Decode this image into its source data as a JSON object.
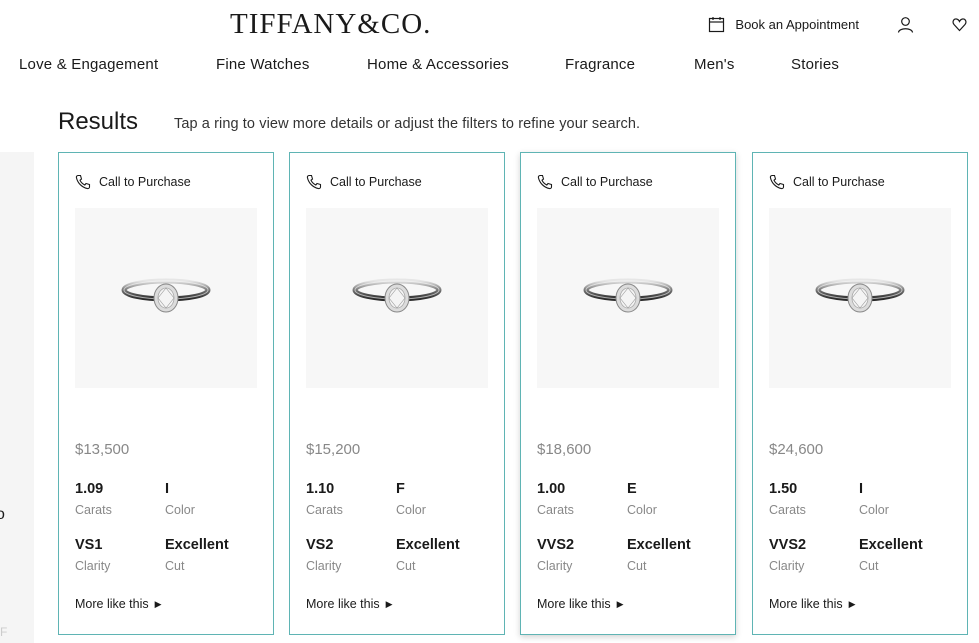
{
  "header": {
    "logo": "TIFFANY&CO.",
    "book_appointment": "Book an Appointment"
  },
  "nav": {
    "items": [
      "Love & Engagement",
      "Fine Watches",
      "Home & Accessories",
      "Fragrance",
      "Men's",
      "Stories"
    ]
  },
  "results": {
    "title": "Results",
    "subtitle": "Tap a ring to view more details or adjust the filters to refine your search."
  },
  "sidebar": {
    "fragment": "o",
    "faded": "F"
  },
  "cards": [
    {
      "call_label": "Call to Purchase",
      "price": "$13,500",
      "carats": "1.09",
      "carats_label": "Carats",
      "color": "I",
      "color_label": "Color",
      "clarity": "VS1",
      "clarity_label": "Clarity",
      "cut": "Excellent",
      "cut_label": "Cut",
      "more_label": "More like this"
    },
    {
      "call_label": "Call to Purchase",
      "price": "$15,200",
      "carats": "1.10",
      "carats_label": "Carats",
      "color": "F",
      "color_label": "Color",
      "clarity": "VS2",
      "clarity_label": "Clarity",
      "cut": "Excellent",
      "cut_label": "Cut",
      "more_label": "More like this"
    },
    {
      "call_label": "Call to Purchase",
      "price": "$18,600",
      "carats": "1.00",
      "carats_label": "Carats",
      "color": "E",
      "color_label": "Color",
      "clarity": "VVS2",
      "clarity_label": "Clarity",
      "cut": "Excellent",
      "cut_label": "Cut",
      "more_label": "More like this"
    },
    {
      "call_label": "Call to Purchase",
      "price": "$24,600",
      "carats": "1.50",
      "carats_label": "Carats",
      "color": "I",
      "color_label": "Color",
      "clarity": "VVS2",
      "clarity_label": "Clarity",
      "cut": "Excellent",
      "cut_label": "Cut",
      "more_label": "More like this"
    }
  ],
  "colors": {
    "card_border": "#5fb4b4",
    "muted_text": "#888888",
    "image_bg": "#f7f7f7"
  }
}
